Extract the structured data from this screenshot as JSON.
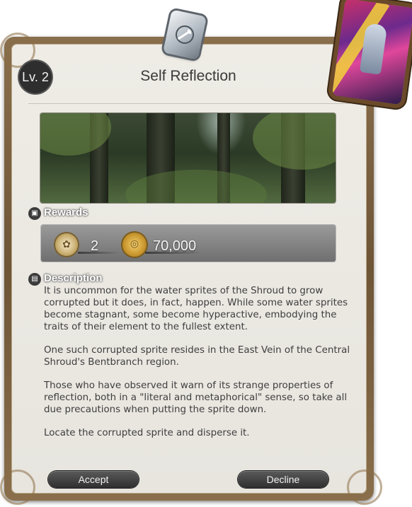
{
  "quest": {
    "level": "Lv. 2",
    "title": "Self Reflection"
  },
  "sections": {
    "rewards_label": "Rewards",
    "description_label": "Description"
  },
  "rewards": [
    {
      "icon": "seal-emblem-icon",
      "value": "2"
    },
    {
      "icon": "gil-coin-icon",
      "value": "70,000"
    }
  ],
  "description": [
    "It is uncommon for the water sprites of the Shroud to grow corrupted but it does, in fact, happen. While some water sprites become stagnant, some become hyperactive, embodying the traits of their element to the fullest extent.",
    "One such corrupted sprite resides in the East Vein of the Central Shroud's Bentbranch region.",
    "Those who have observed it warn of its strange properties of reflection, both in a \"literal and metaphorical\" sense, so take all due precautions when putting the sprite down.",
    "Locate the corrupted sprite and disperse it."
  ],
  "buttons": {
    "accept": "Accept",
    "decline": "Decline"
  },
  "colors": {
    "frame": "#7a5f3e",
    "panel": "#ece9e3",
    "button": "#3a3a3a",
    "rewards_bar": "#858585"
  }
}
